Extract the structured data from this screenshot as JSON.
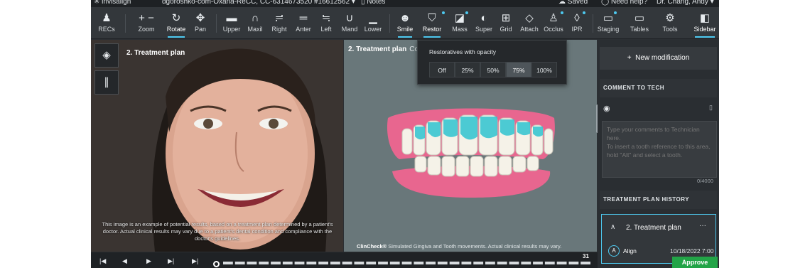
{
  "titlebar": {
    "brand": "invisalign",
    "patient": "dgoroshko-com-Oxana-ReCC, CC-6314673520 #16612562",
    "notes": "Notes",
    "saved": "Saved",
    "help": "Need help?",
    "user": "Dr. Chang, Andy"
  },
  "toolbar": {
    "recs": "RECs",
    "zoom": "Zoom",
    "rotate": "Rotate",
    "pan": "Pan",
    "upper": "Upper",
    "maxil": "Maxil",
    "right": "Right",
    "anter": "Anter",
    "left": "Left",
    "mand": "Mand",
    "lower": "Lower",
    "smile": "Smile",
    "restor": "Restor",
    "mass": "Mass",
    "super": "Super",
    "grid": "Grid",
    "attach": "Attach",
    "occlus": "Occlus",
    "ipr": "IPR",
    "staging": "Staging",
    "tables": "Tables",
    "tools": "Tools",
    "sidebar": "Sidebar"
  },
  "photo": {
    "title": "2. Treatment plan",
    "disclaimer": "This image is an example of potential results, based on a treatment plan determined by a patient's doctor. Actual clinical results may vary due to a patient's dental condition and compliance with the doctor's guidelines."
  },
  "model": {
    "title": "2. Treatment plan",
    "title_suffix": "Co",
    "brand": "ClinCheck®",
    "disclaimer": "Simulated Gingiva and Tooth movements. Actual clinical results may vary."
  },
  "opacity_popup": {
    "title": "Restoratives with opacity",
    "options": [
      "Off",
      "25%",
      "50%",
      "75%",
      "100%"
    ],
    "selected": "75%"
  },
  "sidebar": {
    "new_modification": "New modification",
    "comment_header": "COMMENT TO TECH",
    "comment_placeholder": "Type your comments to Technician here.\nTo insert a tooth reference to this area, hold \"Alt\" and select a tooth.",
    "char_count": "0/4000",
    "history_header": "TREATMENT PLAN HISTORY",
    "history_item": {
      "title": "2. Treatment plan",
      "avatar": "A",
      "author": "Align",
      "date": "10/18/2022 7:00"
    }
  },
  "bottombar": {
    "stage_end": "31"
  },
  "approve": "Approve",
  "colors": {
    "accent": "#4dc9f0",
    "approve": "#22a447",
    "gingiva": "#e8668f",
    "restorative": "#2fc4d0"
  },
  "icons": {
    "recs": "person-icon",
    "zoom": "plus-minus-icon",
    "rotate": "rotate-icon",
    "pan": "move-icon",
    "smile": "smile-icon",
    "restor": "tooth-icon",
    "sidebar": "sidebar-icon"
  }
}
